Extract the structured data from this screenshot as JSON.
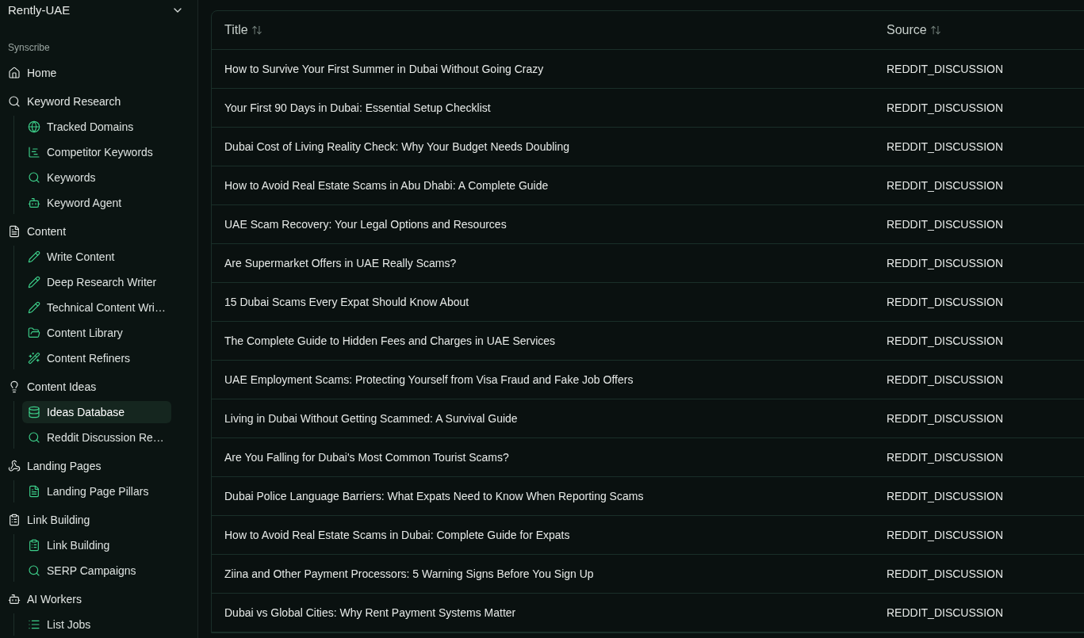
{
  "sidebar": {
    "workspace": {
      "name": "Rently-UAE"
    },
    "section_label": "Synscribe",
    "items": [
      {
        "label": "Home",
        "selected": false
      },
      {
        "label": "Keyword Research",
        "selected": false,
        "children": [
          {
            "label": "Tracked Domains",
            "selected": false
          },
          {
            "label": "Competitor Keywords",
            "selected": false
          },
          {
            "label": "Keywords",
            "selected": false
          },
          {
            "label": "Keyword Agent",
            "selected": false
          }
        ]
      },
      {
        "label": "Content",
        "selected": false,
        "children": [
          {
            "label": "Write Content",
            "selected": false
          },
          {
            "label": "Deep Research Writer",
            "selected": false
          },
          {
            "label": "Technical Content Wri…",
            "selected": false
          },
          {
            "label": "Content Library",
            "selected": false
          },
          {
            "label": "Content Refiners",
            "selected": false
          }
        ]
      },
      {
        "label": "Content Ideas",
        "selected": false,
        "children": [
          {
            "label": "Ideas Database",
            "selected": true
          },
          {
            "label": "Reddit Discussion Re…",
            "selected": false
          }
        ]
      },
      {
        "label": "Landing Pages",
        "selected": false,
        "children": [
          {
            "label": "Landing Page Pillars",
            "selected": false
          }
        ]
      },
      {
        "label": "Link Building",
        "selected": false,
        "children": [
          {
            "label": "Link Building",
            "selected": false
          },
          {
            "label": "SERP Campaigns",
            "selected": false
          }
        ]
      },
      {
        "label": "AI Workers",
        "selected": false,
        "children": [
          {
            "label": "List Jobs",
            "selected": false
          }
        ]
      }
    ]
  },
  "table": {
    "columns": [
      {
        "label": "Title"
      },
      {
        "label": "Source"
      }
    ],
    "rows": [
      {
        "title": "How to Survive Your First Summer in Dubai Without Going Crazy",
        "source": "REDDIT_DISCUSSION"
      },
      {
        "title": "Your First 90 Days in Dubai: Essential Setup Checklist",
        "source": "REDDIT_DISCUSSION"
      },
      {
        "title": "Dubai Cost of Living Reality Check: Why Your Budget Needs Doubling",
        "source": "REDDIT_DISCUSSION"
      },
      {
        "title": "How to Avoid Real Estate Scams in Abu Dhabi: A Complete Guide",
        "source": "REDDIT_DISCUSSION"
      },
      {
        "title": "UAE Scam Recovery: Your Legal Options and Resources",
        "source": "REDDIT_DISCUSSION"
      },
      {
        "title": "Are Supermarket Offers in UAE Really Scams?",
        "source": "REDDIT_DISCUSSION"
      },
      {
        "title": "15 Dubai Scams Every Expat Should Know About",
        "source": "REDDIT_DISCUSSION"
      },
      {
        "title": "The Complete Guide to Hidden Fees and Charges in UAE Services",
        "source": "REDDIT_DISCUSSION"
      },
      {
        "title": "UAE Employment Scams: Protecting Yourself from Visa Fraud and Fake Job Offers",
        "source": "REDDIT_DISCUSSION"
      },
      {
        "title": "Living in Dubai Without Getting Scammed: A Survival Guide",
        "source": "REDDIT_DISCUSSION"
      },
      {
        "title": "Are You Falling for Dubai's Most Common Tourist Scams?",
        "source": "REDDIT_DISCUSSION"
      },
      {
        "title": "Dubai Police Language Barriers: What Expats Need to Know When Reporting Scams",
        "source": "REDDIT_DISCUSSION"
      },
      {
        "title": "How to Avoid Real Estate Scams in Dubai: Complete Guide for Expats",
        "source": "REDDIT_DISCUSSION"
      },
      {
        "title": "Ziina and Other Payment Processors: 5 Warning Signs Before You Sign Up",
        "source": "REDDIT_DISCUSSION"
      },
      {
        "title": "Dubai vs Global Cities: Why Rent Payment Systems Matter",
        "source": "REDDIT_DISCUSSION"
      }
    ]
  }
}
